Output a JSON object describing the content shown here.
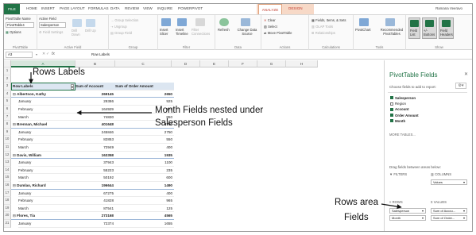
{
  "colors": {
    "accent": "#217346",
    "context_tab": "#c0392b",
    "pivot_header": "#dce6f1"
  },
  "ribbon_tabs": [
    "FILE",
    "HOME",
    "INSERT",
    "PAGE LAYOUT",
    "FORMULAS",
    "DATA",
    "REVIEW",
    "VIEW",
    "INQUIRE",
    "POWERPIVOT",
    "ANALYZE",
    "DESIGN"
  ],
  "user_name": "Ramana Veeravo",
  "ribbon": {
    "pivottable_name_label": "PivotTable Name",
    "pivottable_name_value": "PivotTable4",
    "options_label": "Options",
    "active_field_label": "Active Field",
    "active_field_value": "Salesperson",
    "field_settings_label": "Field Settings",
    "drill_down_label": "Drill Down",
    "drill_up_label": "Drill Up",
    "group_selection_label": "Group Selection",
    "ungroup_label": "Ungroup",
    "group_field_label": "Group Field",
    "insert_slicer_label": "Insert Slicer",
    "insert_timeline_label": "Insert Timeline",
    "filter_connections_label": "Filter Connections",
    "refresh_label": "Refresh",
    "change_data_source_label": "Change Data Source",
    "clear_label": "Clear",
    "select_label": "Select",
    "move_pivottable_label": "Move PivotTable",
    "fields_items_sets_label": "Fields, Items, & Sets",
    "olap_tools_label": "OLAP Tools",
    "relationships_label": "Relationships",
    "pivotchart_label": "PivotChart",
    "recommended_label": "Recommended PivotTables",
    "field_list_label": "Field List",
    "buttons_label": "+/- Buttons",
    "field_headers_label": "Field Headers",
    "groups": [
      "PivotTable",
      "Active Field",
      "Group",
      "Filter",
      "Data",
      "Actions",
      "Calculations",
      "Tools",
      "Show"
    ]
  },
  "formula_bar": {
    "name_box": "A3",
    "fx": "fx",
    "content": "Row Labels"
  },
  "columns": [
    "A",
    "B",
    "C",
    "D",
    "E",
    "F",
    "G",
    "H"
  ],
  "row_numbers": [
    "1",
    "2",
    "3",
    "4",
    "5",
    "6",
    "7",
    "8",
    "9",
    "10",
    "11",
    "12",
    "13",
    "14",
    "15",
    "16",
    "17",
    "18",
    "19",
    "20",
    "21"
  ],
  "pivot": {
    "headers": [
      "Row Labels",
      "Sum of Account",
      "Sum of Order Amount"
    ],
    "rows": [
      {
        "label": "Albertson, Kathy",
        "account": "269145",
        "amount": "2650",
        "level": 0
      },
      {
        "label": "January",
        "account": "29386",
        "amount": "925",
        "level": 1
      },
      {
        "label": "February",
        "account": "164929",
        "amount": "875",
        "level": 1
      },
      {
        "label": "March",
        "account": "74830",
        "amount": "850",
        "level": 1
      },
      {
        "label": "Brennan, Michael",
        "account": "401648",
        "amount": "3700",
        "level": 0
      },
      {
        "label": "January",
        "account": "245846",
        "amount": "2750",
        "level": 1
      },
      {
        "label": "February",
        "account": "82853",
        "amount": "550",
        "level": 1
      },
      {
        "label": "March",
        "account": "72949",
        "amount": "400",
        "level": 1
      },
      {
        "label": "Davis, William",
        "account": "163358",
        "amount": "1935",
        "level": 0
      },
      {
        "label": "January",
        "account": "37943",
        "amount": "1100",
        "level": 1
      },
      {
        "label": "February",
        "account": "55223",
        "amount": "235",
        "level": 1
      },
      {
        "label": "March",
        "account": "50192",
        "amount": "600",
        "level": 1
      },
      {
        "label": "Dumlao, Richard",
        "account": "196644",
        "amount": "1490",
        "level": 0
      },
      {
        "label": "January",
        "account": "67275",
        "amount": "400",
        "level": 1
      },
      {
        "label": "February",
        "account": "41828",
        "amount": "965",
        "level": 1
      },
      {
        "label": "March",
        "account": "87541",
        "amount": "125",
        "level": 1
      },
      {
        "label": "Flores, Tia",
        "account": "273168",
        "amount": "4565",
        "level": 0
      },
      {
        "label": "January",
        "account": "72374",
        "amount": "1655",
        "level": 1
      }
    ]
  },
  "annotations": {
    "rows_labels": "Rows Labels",
    "month_fields_line1": "Month Fields nested under",
    "month_fields_line2": "Salesperson Fields",
    "rows_area_line1": "Rows area",
    "rows_area_line2": "Fields"
  },
  "panel": {
    "title": "PivotTable Fields",
    "subtitle": "Choose fields to add to report:",
    "fields": [
      {
        "name": "Salesperson",
        "checked": true
      },
      {
        "name": "Region",
        "checked": false
      },
      {
        "name": "Account",
        "checked": true
      },
      {
        "name": "Order Amount",
        "checked": true
      },
      {
        "name": "Month",
        "checked": true
      }
    ],
    "more_tables": "MORE TABLES...",
    "drag_hint": "Drag fields between areas below:",
    "filters_label": "FILTERS",
    "columns_label": "COLUMNS",
    "columns_value": "Values",
    "rows_label": "ROWS",
    "values_label": "VALUES",
    "rows_values": [
      "Salesperson",
      "Month"
    ],
    "values_values": [
      "Sum of Accou...",
      "Sum of Order..."
    ]
  }
}
